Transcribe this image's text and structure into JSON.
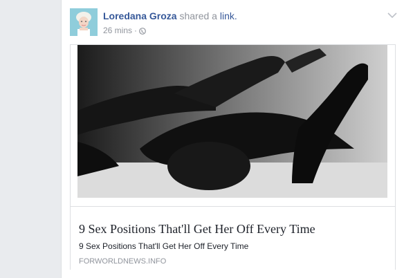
{
  "post": {
    "author": "Loredana Groza",
    "action": "shared a",
    "object": "link.",
    "time": "26 mins",
    "separator": "·",
    "privacy_icon": "globe-icon",
    "menu_icon": "chevron-down-icon"
  },
  "link_preview": {
    "title": "9 Sex Positions That'll Get Her Off Every Time",
    "description": "9 Sex Positions That'll Get Her Off Every Time",
    "domain": "FORWORLDNEWS.INFO"
  },
  "colors": {
    "name": "#365899",
    "meta": "#90949c",
    "text": "#1d2129",
    "border": "#dddfe2",
    "background": "#e9ebee"
  }
}
